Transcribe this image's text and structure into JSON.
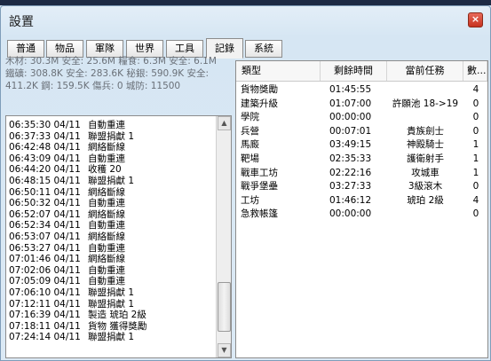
{
  "window": {
    "title": "設置",
    "close_icon": "×"
  },
  "tabs": [
    {
      "label": "普通",
      "active": false
    },
    {
      "label": "物品",
      "active": false
    },
    {
      "label": "軍隊",
      "active": false
    },
    {
      "label": "世界",
      "active": false
    },
    {
      "label": "工具",
      "active": false
    },
    {
      "label": "記錄",
      "active": true
    },
    {
      "label": "系統",
      "active": false
    }
  ],
  "resources": {
    "line1": "木材: 30.3M 安全: 25.6M  糧食: 6.3M 安全: 6.1M",
    "line2": "鐵礦: 308.8K 安全: 283.6K  秘銀: 590.9K 安全:",
    "line3": "411.2K  鋼: 159.5K  傷兵: 0  城防: 11500"
  },
  "log": [
    {
      "time": "06:35:30 04/11",
      "text": "自動重連"
    },
    {
      "time": "06:37:33 04/11",
      "text": "聯盟捐獻   1"
    },
    {
      "time": "06:42:48 04/11",
      "text": "網絡斷線"
    },
    {
      "time": "06:43:09 04/11",
      "text": "自動重連"
    },
    {
      "time": "06:44:20 04/11",
      "text": "收穫   20"
    },
    {
      "time": "06:48:15 04/11",
      "text": "聯盟捐獻   1"
    },
    {
      "time": "06:50:11 04/11",
      "text": "網絡斷線"
    },
    {
      "time": "06:50:32 04/11",
      "text": "自動重連"
    },
    {
      "time": "06:52:07 04/11",
      "text": "網絡斷線"
    },
    {
      "time": "06:52:34 04/11",
      "text": "自動重連"
    },
    {
      "time": "06:53:07 04/11",
      "text": "網絡斷線"
    },
    {
      "time": "06:53:27 04/11",
      "text": "自動重連"
    },
    {
      "time": "07:01:46 04/11",
      "text": "網絡斷線"
    },
    {
      "time": "07:02:06 04/11",
      "text": "自動重連"
    },
    {
      "time": "07:05:09 04/11",
      "text": "自動重連"
    },
    {
      "time": "07:06:10 04/11",
      "text": "聯盟捐獻   1"
    },
    {
      "time": "07:12:11 04/11",
      "text": "聯盟捐獻   1"
    },
    {
      "time": "07:16:39 04/11",
      "text": "製造   琥珀 2級"
    },
    {
      "time": "07:18:11 04/11",
      "text": "貨物   獲得獎勵"
    },
    {
      "time": "07:24:14 04/11",
      "text": "聯盟捐獻   1"
    }
  ],
  "table": {
    "headers": [
      "類型",
      "剩餘時間",
      "當前任務",
      "數..."
    ],
    "rows": [
      {
        "type": "貨物獎勵",
        "time": "01:45:55",
        "task": "",
        "count": "4"
      },
      {
        "type": "建築升級",
        "time": "01:07:00",
        "task": "許願池 18->19",
        "count": "0"
      },
      {
        "type": "學院",
        "time": "00:00:00",
        "task": "",
        "count": "0"
      },
      {
        "type": "兵營",
        "time": "00:07:01",
        "task": "貴族劍士",
        "count": "0"
      },
      {
        "type": "馬廄",
        "time": "03:49:15",
        "task": "神殿騎士",
        "count": "1"
      },
      {
        "type": "靶場",
        "time": "02:35:33",
        "task": "護衛射手",
        "count": "1"
      },
      {
        "type": "戰車工坊",
        "time": "02:22:16",
        "task": "攻城車",
        "count": "1"
      },
      {
        "type": "戰爭堡壘",
        "time": "03:27:33",
        "task": "3級滾木",
        "count": "0"
      },
      {
        "type": "工坊",
        "time": "01:46:12",
        "task": "琥珀 2級",
        "count": "4"
      },
      {
        "type": "急救帳篷",
        "time": "00:00:00",
        "task": "",
        "count": "0"
      }
    ]
  },
  "colors": {
    "accent": "#c7321f",
    "panel_bg": "#d6e6f3",
    "resource_text": "#6a7078"
  }
}
